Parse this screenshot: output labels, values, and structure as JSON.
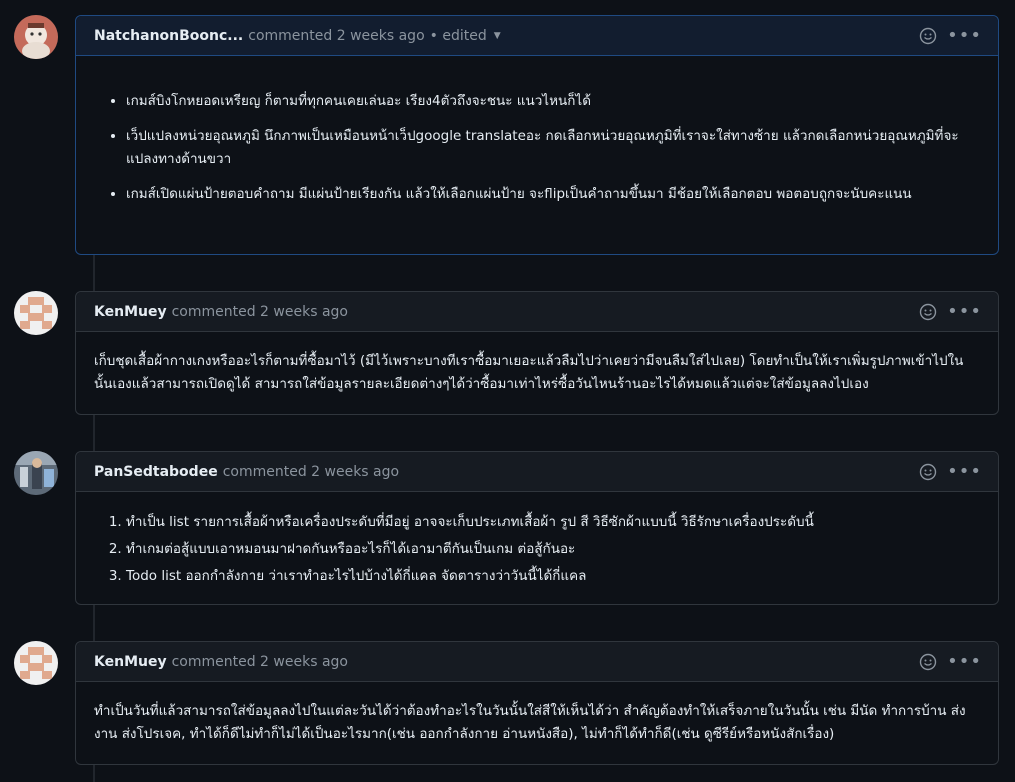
{
  "comments": [
    {
      "author": "NatchanonBoonc...",
      "meta": "commented 2 weeks ago",
      "edited": "• edited",
      "body_type": "bullets",
      "items": [
        "เกมส์บิงโกหยอดเหรียญ ก็ตามที่ทุกคนเคยเล่นอะ เรียง4ตัวถึงจะชนะ แนวไหนก็ได้",
        "เว็ปแปลงหน่วยอุณหภูมิ นึกภาพเป็นเหมือนหน้าเว็ปgoogle translateอะ กดเลือกหน่วยอุณหภูมิที่เราจะใส่ทางซ้าย แล้วกดเลือกหน่วยอุณหภูมิที่จะแปลงทางด้านขวา",
        "เกมส์เปิดแผ่นป้ายตอบคำถาม มีแผ่นป้ายเรียงกัน แล้วให้เลือกแผ่นป้าย จะflipเป็นคำถามขึ้นมา มีช้อยให้เลือกตอบ พอตอบถูกจะนับคะแนน"
      ]
    },
    {
      "author": "KenMuey",
      "meta": "commented 2 weeks ago",
      "body_type": "text",
      "text": "เก็บชุดเสื้อผ้ากางเกงหรืออะไรก็ตามที่ซื้อมาไว้ (มีไว้เพราะบางทีเราซื้อมาเยอะแล้วลืมไปว่าเคยว่ามีจนลืมใส่ไปเลย) โดยทำเป็นให้เราเพิ่มรูปภาพเข้าไปในนั้นเองแล้วสามารถเปิดดูได้ สามารถใส่ข้อมูลรายละเอียดต่างๆได้ว่าซื้อมาเท่าไหร่ซื้อวันไหนร้านอะไรได้หมดแล้วแต่จะใส่ข้อมูลลงไปเอง"
    },
    {
      "author": "PanSedtabodee",
      "meta": "commented 2 weeks ago",
      "body_type": "numbers",
      "items": [
        "ทำเป็น list รายการเสื้อผ้าหรือเครื่องประดับที่มีอยู่ อาจจะเก็บประเภทเสื้อผ้า รูป สี วิธีซักผ้าแบบนี้ วิธีรักษาเครื่องประดับนี้",
        "ทำเกมต่อสู้แบบเอาหมอนมาฝาดกันหรืออะไรก็ได้เอามาตีกันเป็นเกม ต่อสู้กันอะ",
        "Todo list ออกกำลังกาย ว่าเราทำอะไรไปบ้างได้กี่แคล จัดตารางว่าวันนี้ได้กี่แคล"
      ]
    },
    {
      "author": "KenMuey",
      "meta": "commented 2 weeks ago",
      "body_type": "text",
      "text": "ทำเป็นวันที่แล้วสามารถใส่ข้อมูลลงไปในแต่ละวันได้ว่าต้องทำอะไรในวันนั้นใส่สีให้เห็นได้ว่า สำคัญต้องทำให้เสร็จภายในวันนั้น เช่น มีนัด ทำการบ้าน ส่งงาน ส่งโปรเจค, ทำได้ก็ดีไม่ทำก็ไม่ได้เป็นอะไรมาก(เช่น ออกกำลังกาย อ่านหนังสือ), ไม่ทำก็ได้ทำก็ดี(เช่น ดูซีรีย์หรือหนังสักเรื่อง)"
    }
  ],
  "icons": {
    "reaction": "smiley-icon",
    "menu": "kebab-icon",
    "dropdown": "caret-down-icon"
  },
  "colors": {
    "accent_border": "#1f4a82",
    "border": "#30363d",
    "bg": "#0d1117"
  }
}
